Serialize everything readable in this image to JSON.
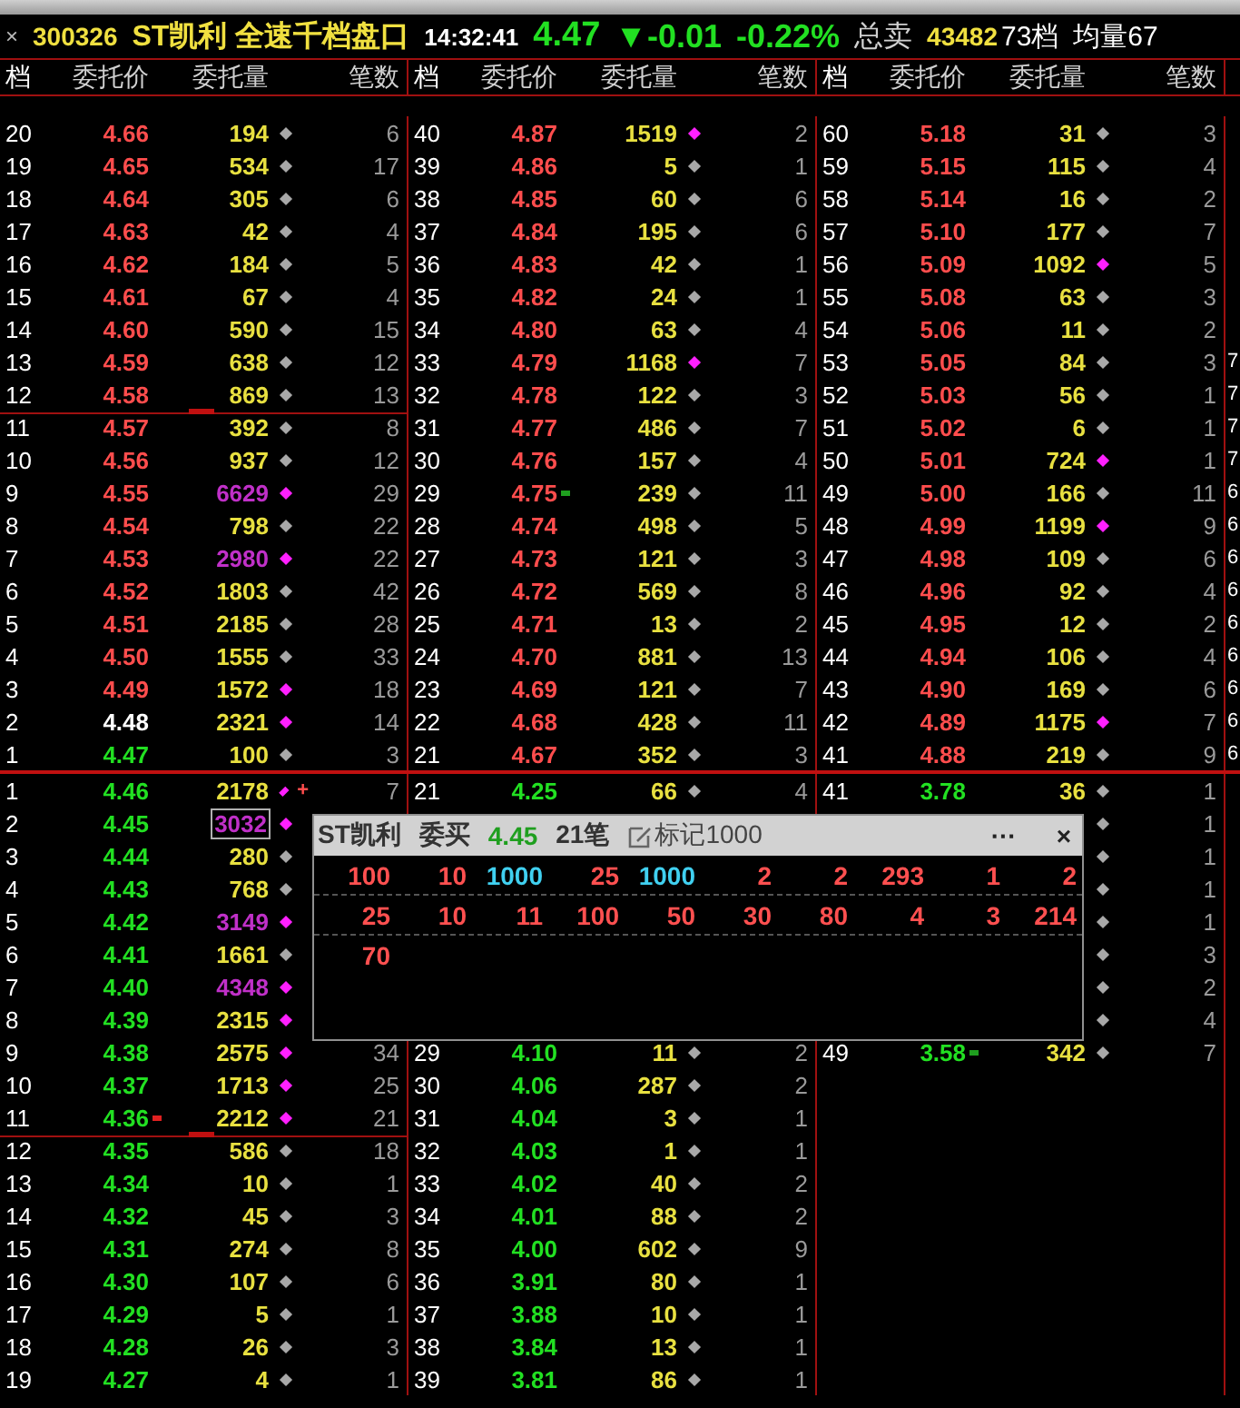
{
  "header": {
    "close": "×",
    "code": "300326",
    "title": "ST凯利 全速千档盘口",
    "time": "14:32:41",
    "price": "4.47",
    "change": "▼-0.01",
    "percent": "-0.22%",
    "total_label": "总卖",
    "total": "43482",
    "depth": "73档",
    "average": "均量67"
  },
  "column_headers": [
    {
      "labels": [
        "档",
        "委托价",
        "委托量",
        "笔数"
      ]
    },
    {
      "labels": [
        "档",
        "委托价",
        "委托量",
        "笔数"
      ]
    },
    {
      "labels": [
        "档",
        "委托价",
        "委托量",
        "笔数"
      ]
    }
  ],
  "sell": [
    {
      "left": {
        "level": "20",
        "price": "4.66",
        "up": true,
        "qty": "194",
        "big": false,
        "flag": false,
        "count": "6"
      },
      "mid": {
        "level": "40",
        "price": "4.87",
        "up": true,
        "qty": "1519",
        "big": false,
        "flag": true,
        "count": "2"
      },
      "right": {
        "level": "60",
        "price": "5.18",
        "up": true,
        "qty": "31",
        "big": false,
        "flag": false,
        "count": "3"
      }
    },
    {
      "left": {
        "level": "19",
        "price": "4.65",
        "up": true,
        "qty": "534",
        "big": false,
        "flag": false,
        "count": "17"
      },
      "mid": {
        "level": "39",
        "price": "4.86",
        "up": true,
        "qty": "5",
        "big": false,
        "flag": false,
        "count": "1"
      },
      "right": {
        "level": "59",
        "price": "5.15",
        "up": true,
        "qty": "115",
        "big": false,
        "flag": false,
        "count": "4"
      }
    },
    {
      "left": {
        "level": "18",
        "price": "4.64",
        "up": true,
        "qty": "305",
        "big": false,
        "flag": false,
        "count": "6"
      },
      "mid": {
        "level": "38",
        "price": "4.85",
        "up": true,
        "qty": "60",
        "big": false,
        "flag": false,
        "count": "6"
      },
      "right": {
        "level": "58",
        "price": "5.14",
        "up": true,
        "qty": "16",
        "big": false,
        "flag": false,
        "count": "2"
      }
    },
    {
      "left": {
        "level": "17",
        "price": "4.63",
        "up": true,
        "qty": "42",
        "big": false,
        "flag": false,
        "count": "4"
      },
      "mid": {
        "level": "37",
        "price": "4.84",
        "up": true,
        "qty": "195",
        "big": false,
        "flag": false,
        "count": "6"
      },
      "right": {
        "level": "57",
        "price": "5.10",
        "up": true,
        "qty": "177",
        "big": false,
        "flag": false,
        "count": "7"
      }
    },
    {
      "left": {
        "level": "16",
        "price": "4.62",
        "up": true,
        "qty": "184",
        "big": false,
        "flag": false,
        "count": "5"
      },
      "mid": {
        "level": "36",
        "price": "4.83",
        "up": true,
        "qty": "42",
        "big": false,
        "flag": false,
        "count": "1"
      },
      "right": {
        "level": "56",
        "price": "5.09",
        "up": true,
        "qty": "1092",
        "big": false,
        "flag": true,
        "count": "5"
      }
    },
    {
      "left": {
        "level": "15",
        "price": "4.61",
        "up": true,
        "qty": "67",
        "big": false,
        "flag": false,
        "count": "4"
      },
      "mid": {
        "level": "35",
        "price": "4.82",
        "up": true,
        "qty": "24",
        "big": false,
        "flag": false,
        "count": "1"
      },
      "right": {
        "level": "55",
        "price": "5.08",
        "up": true,
        "qty": "63",
        "big": false,
        "flag": false,
        "count": "3"
      }
    },
    {
      "left": {
        "level": "14",
        "price": "4.60",
        "up": true,
        "qty": "590",
        "big": false,
        "flag": false,
        "count": "15"
      },
      "mid": {
        "level": "34",
        "price": "4.80",
        "up": true,
        "qty": "63",
        "big": false,
        "flag": false,
        "count": "4"
      },
      "right": {
        "level": "54",
        "price": "5.06",
        "up": true,
        "qty": "11",
        "big": false,
        "flag": false,
        "count": "2"
      }
    },
    {
      "left": {
        "level": "13",
        "price": "4.59",
        "up": true,
        "qty": "638",
        "big": false,
        "flag": false,
        "count": "12"
      },
      "mid": {
        "level": "33",
        "price": "4.79",
        "up": true,
        "qty": "1168",
        "big": false,
        "flag": true,
        "count": "7"
      },
      "right": {
        "level": "53",
        "price": "5.05",
        "up": true,
        "qty": "84",
        "big": false,
        "flag": false,
        "count": "3"
      },
      "edge": "7"
    },
    {
      "left": {
        "level": "12",
        "price": "4.58",
        "up": true,
        "qty": "869",
        "big": false,
        "flag": false,
        "count": "13",
        "rule": true
      },
      "mid": {
        "level": "32",
        "price": "4.78",
        "up": true,
        "qty": "122",
        "big": false,
        "flag": false,
        "count": "3"
      },
      "right": {
        "level": "52",
        "price": "5.03",
        "up": true,
        "qty": "56",
        "big": false,
        "flag": false,
        "count": "1"
      },
      "edge": "7"
    },
    {
      "left": {
        "level": "11",
        "price": "4.57",
        "up": true,
        "qty": "392",
        "big": false,
        "flag": false,
        "count": "8"
      },
      "mid": {
        "level": "31",
        "price": "4.77",
        "up": true,
        "qty": "486",
        "big": false,
        "flag": false,
        "count": "7"
      },
      "right": {
        "level": "51",
        "price": "5.02",
        "up": true,
        "qty": "6",
        "big": false,
        "flag": false,
        "count": "1"
      },
      "edge": "7"
    },
    {
      "left": {
        "level": "10",
        "price": "4.56",
        "up": true,
        "qty": "937",
        "big": false,
        "flag": false,
        "count": "12"
      },
      "mid": {
        "level": "30",
        "price": "4.76",
        "up": true,
        "qty": "157",
        "big": false,
        "flag": false,
        "count": "4"
      },
      "right": {
        "level": "50",
        "price": "5.01",
        "up": true,
        "qty": "724",
        "big": false,
        "flag": true,
        "count": "1"
      },
      "edge": "7"
    },
    {
      "left": {
        "level": "9",
        "price": "4.55",
        "up": true,
        "qty": "6629",
        "big": true,
        "flag": true,
        "count": "29"
      },
      "mid": {
        "level": "29",
        "price": "4.75",
        "up": true,
        "dot": {
          "color": "#1f9f1f"
        },
        "qty": "239",
        "big": false,
        "flag": false,
        "count": "11"
      },
      "right": {
        "level": "49",
        "price": "5.00",
        "up": true,
        "qty": "166",
        "big": false,
        "flag": false,
        "count": "11"
      },
      "edge": "6"
    },
    {
      "left": {
        "level": "8",
        "price": "4.54",
        "up": true,
        "qty": "798",
        "big": false,
        "flag": false,
        "count": "22"
      },
      "mid": {
        "level": "28",
        "price": "4.74",
        "up": true,
        "qty": "498",
        "big": false,
        "flag": false,
        "count": "5"
      },
      "right": {
        "level": "48",
        "price": "4.99",
        "up": true,
        "qty": "1199",
        "big": false,
        "flag": true,
        "count": "9"
      },
      "edge": "6"
    },
    {
      "left": {
        "level": "7",
        "price": "4.53",
        "up": true,
        "qty": "2980",
        "big": true,
        "flag": true,
        "count": "22"
      },
      "mid": {
        "level": "27",
        "price": "4.73",
        "up": true,
        "qty": "121",
        "big": false,
        "flag": false,
        "count": "3"
      },
      "right": {
        "level": "47",
        "price": "4.98",
        "up": true,
        "qty": "109",
        "big": false,
        "flag": false,
        "count": "6"
      },
      "edge": "6"
    },
    {
      "left": {
        "level": "6",
        "price": "4.52",
        "up": true,
        "qty": "1803",
        "big": false,
        "flag": false,
        "count": "42"
      },
      "mid": {
        "level": "26",
        "price": "4.72",
        "up": true,
        "qty": "569",
        "big": false,
        "flag": false,
        "count": "8"
      },
      "right": {
        "level": "46",
        "price": "4.96",
        "up": true,
        "qty": "92",
        "big": false,
        "flag": false,
        "count": "4"
      },
      "edge": "6"
    },
    {
      "left": {
        "level": "5",
        "price": "4.51",
        "up": true,
        "qty": "2185",
        "big": false,
        "flag": false,
        "count": "28"
      },
      "mid": {
        "level": "25",
        "price": "4.71",
        "up": true,
        "qty": "13",
        "big": false,
        "flag": false,
        "count": "2"
      },
      "right": {
        "level": "45",
        "price": "4.95",
        "up": true,
        "qty": "12",
        "big": false,
        "flag": false,
        "count": "2"
      },
      "edge": "6"
    },
    {
      "left": {
        "level": "4",
        "price": "4.50",
        "up": true,
        "qty": "1555",
        "big": false,
        "flag": false,
        "count": "33"
      },
      "mid": {
        "level": "24",
        "price": "4.70",
        "up": true,
        "qty": "881",
        "big": false,
        "flag": false,
        "count": "13"
      },
      "right": {
        "level": "44",
        "price": "4.94",
        "up": true,
        "qty": "106",
        "big": false,
        "flag": false,
        "count": "4"
      },
      "edge": "6"
    },
    {
      "left": {
        "level": "3",
        "price": "4.49",
        "up": true,
        "qty": "1572",
        "big": false,
        "flag": true,
        "count": "18"
      },
      "mid": {
        "level": "23",
        "price": "4.69",
        "up": true,
        "qty": "121",
        "big": false,
        "flag": false,
        "count": "7"
      },
      "right": {
        "level": "43",
        "price": "4.90",
        "up": true,
        "qty": "169",
        "big": false,
        "flag": false,
        "count": "6"
      },
      "edge": "6"
    },
    {
      "left": {
        "level": "2",
        "price": "4.48",
        "flat": true,
        "qty": "2321",
        "big": false,
        "flag": true,
        "count": "14"
      },
      "mid": {
        "level": "22",
        "price": "4.68",
        "up": true,
        "qty": "428",
        "big": false,
        "flag": false,
        "count": "11"
      },
      "right": {
        "level": "42",
        "price": "4.89",
        "up": true,
        "qty": "1175",
        "big": false,
        "flag": true,
        "count": "7"
      },
      "edge": "6"
    },
    {
      "left": {
        "level": "1",
        "price": "4.47",
        "up": false,
        "qty": "100",
        "big": false,
        "flag": false,
        "count": "3"
      },
      "mid": {
        "level": "21",
        "price": "4.67",
        "up": true,
        "qty": "352",
        "big": false,
        "flag": false,
        "count": "3"
      },
      "right": {
        "level": "41",
        "price": "4.88",
        "up": true,
        "qty": "219",
        "big": false,
        "flag": false,
        "count": "9"
      },
      "edge": "6"
    }
  ],
  "buy": [
    {
      "left": {
        "level": "1",
        "price": "4.46",
        "up": false,
        "qty": "2178",
        "big": false,
        "flag": true,
        "after": "+",
        "count": "7"
      },
      "mid": {
        "level": "21",
        "price": "4.25",
        "up": false,
        "qty": "66",
        "big": false,
        "flag": false,
        "count": "4"
      },
      "right": {
        "level": "41",
        "price": "3.78",
        "up": false,
        "qty": "36",
        "big": false,
        "flag": false,
        "count": "1"
      }
    },
    {
      "left": {
        "level": "2",
        "price": "4.45",
        "up": false,
        "qty": "3032",
        "big": true,
        "flag": true,
        "outlined": true
      },
      "right": {
        "flag": false,
        "count": "1"
      }
    },
    {
      "left": {
        "level": "3",
        "price": "4.44",
        "up": false,
        "qty": "280",
        "big": false,
        "flag": false
      },
      "right": {
        "flag": false,
        "count": "1"
      }
    },
    {
      "left": {
        "level": "4",
        "price": "4.43",
        "up": false,
        "qty": "768",
        "big": false,
        "flag": false
      },
      "right": {
        "flag": false,
        "count": "1"
      }
    },
    {
      "left": {
        "level": "5",
        "price": "4.42",
        "up": false,
        "qty": "3149",
        "big": true,
        "flag": true
      },
      "right": {
        "flag": false,
        "count": "1"
      }
    },
    {
      "left": {
        "level": "6",
        "price": "4.41",
        "up": false,
        "qty": "1661",
        "big": false,
        "flag": false
      },
      "right": {
        "flag": false,
        "count": "3"
      }
    },
    {
      "left": {
        "level": "7",
        "price": "4.40",
        "up": false,
        "qty": "4348",
        "big": true,
        "flag": true
      },
      "right": {
        "flag": false,
        "count": "2"
      }
    },
    {
      "left": {
        "level": "8",
        "price": "4.39",
        "up": false,
        "qty": "2315",
        "big": false,
        "flag": true
      },
      "right": {
        "flag": false,
        "count": "4"
      }
    },
    {
      "left": {
        "level": "9",
        "price": "4.38",
        "up": false,
        "qty": "2575",
        "big": false,
        "flag": true,
        "count": "34"
      },
      "mid": {
        "level": "29",
        "price": "4.10",
        "up": false,
        "qty": "11",
        "big": false,
        "flag": false,
        "count": "2"
      },
      "right": {
        "level": "49",
        "price": "3.58",
        "up": false,
        "dot": {
          "color": "#1f9f1f"
        },
        "qty": "342",
        "big": false,
        "flag": false,
        "count": "7"
      }
    },
    {
      "left": {
        "level": "10",
        "price": "4.37",
        "up": false,
        "qty": "1713",
        "big": false,
        "flag": true,
        "count": "25"
      },
      "mid": {
        "level": "30",
        "price": "4.06",
        "up": false,
        "qty": "287",
        "big": false,
        "flag": false,
        "count": "2"
      }
    },
    {
      "left": {
        "level": "11",
        "price": "4.36",
        "up": false,
        "dot": {
          "color": "#e02020"
        },
        "qty": "2212",
        "big": false,
        "flag": true,
        "count": "21",
        "rule": true
      },
      "mid": {
        "level": "31",
        "price": "4.04",
        "up": false,
        "qty": "3",
        "big": false,
        "flag": false,
        "count": "1"
      }
    },
    {
      "left": {
        "level": "12",
        "price": "4.35",
        "up": false,
        "qty": "586",
        "big": false,
        "flag": false,
        "count": "18"
      },
      "mid": {
        "level": "32",
        "price": "4.03",
        "up": false,
        "qty": "1",
        "big": false,
        "flag": false,
        "count": "1"
      }
    },
    {
      "left": {
        "level": "13",
        "price": "4.34",
        "up": false,
        "qty": "10",
        "big": false,
        "flag": false,
        "count": "1"
      },
      "mid": {
        "level": "33",
        "price": "4.02",
        "up": false,
        "qty": "40",
        "big": false,
        "flag": false,
        "count": "2"
      }
    },
    {
      "left": {
        "level": "14",
        "price": "4.32",
        "up": false,
        "qty": "45",
        "big": false,
        "flag": false,
        "count": "3"
      },
      "mid": {
        "level": "34",
        "price": "4.01",
        "up": false,
        "qty": "88",
        "big": false,
        "flag": false,
        "count": "2"
      }
    },
    {
      "left": {
        "level": "15",
        "price": "4.31",
        "up": false,
        "qty": "274",
        "big": false,
        "flag": false,
        "count": "8"
      },
      "mid": {
        "level": "35",
        "price": "4.00",
        "up": false,
        "qty": "602",
        "big": false,
        "flag": false,
        "count": "9"
      }
    },
    {
      "left": {
        "level": "16",
        "price": "4.30",
        "up": false,
        "qty": "107",
        "big": false,
        "flag": false,
        "count": "6"
      },
      "mid": {
        "level": "36",
        "price": "3.91",
        "up": false,
        "qty": "80",
        "big": false,
        "flag": false,
        "count": "1"
      }
    },
    {
      "left": {
        "level": "17",
        "price": "4.29",
        "up": false,
        "qty": "5",
        "big": false,
        "flag": false,
        "count": "1"
      },
      "mid": {
        "level": "37",
        "price": "3.88",
        "up": false,
        "qty": "10",
        "big": false,
        "flag": false,
        "count": "1"
      }
    },
    {
      "left": {
        "level": "18",
        "price": "4.28",
        "up": false,
        "qty": "26",
        "big": false,
        "flag": false,
        "count": "3"
      },
      "mid": {
        "level": "38",
        "price": "3.84",
        "up": false,
        "qty": "13",
        "big": false,
        "flag": false,
        "count": "1"
      }
    },
    {
      "left": {
        "level": "19",
        "price": "4.27",
        "up": false,
        "qty": "4",
        "big": false,
        "flag": false,
        "count": "1"
      },
      "mid": {
        "level": "39",
        "price": "3.81",
        "up": false,
        "qty": "86",
        "big": false,
        "flag": false,
        "count": "1"
      }
    }
  ],
  "popup": {
    "name": "ST凯利",
    "side": "委买",
    "price": "4.45",
    "orders_count": "21笔",
    "mark_label": "标记1000",
    "more": "···",
    "close": "×",
    "orders": [
      {
        "qty": "100",
        "marked": false
      },
      {
        "qty": "10",
        "marked": false
      },
      {
        "qty": "1000",
        "marked": true
      },
      {
        "qty": "25",
        "marked": false
      },
      {
        "qty": "1000",
        "marked": true
      },
      {
        "qty": "2",
        "marked": false
      },
      {
        "qty": "2",
        "marked": false
      },
      {
        "qty": "293",
        "marked": false
      },
      {
        "qty": "1",
        "marked": false
      },
      {
        "qty": "2",
        "marked": false
      },
      {
        "qty": "25",
        "marked": false
      },
      {
        "qty": "10",
        "marked": false
      },
      {
        "qty": "11",
        "marked": false
      },
      {
        "qty": "100",
        "marked": false
      },
      {
        "qty": "50",
        "marked": false
      },
      {
        "qty": "30",
        "marked": false
      },
      {
        "qty": "80",
        "marked": false
      },
      {
        "qty": "4",
        "marked": false
      },
      {
        "qty": "3",
        "marked": false
      },
      {
        "qty": "214",
        "marked": false
      },
      {
        "qty": "70",
        "marked": false
      }
    ]
  }
}
